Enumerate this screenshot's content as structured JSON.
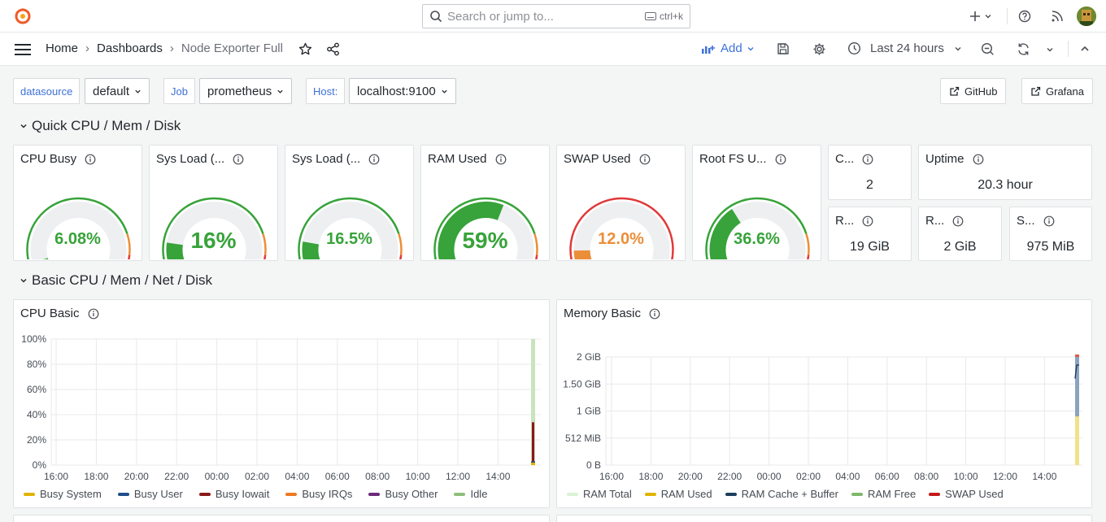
{
  "topbar": {
    "search_placeholder": "Search or jump to...",
    "search_shortcut": "ctrl+k",
    "icons": [
      "grafana-logo-icon",
      "search-icon",
      "plus-icon",
      "help-icon",
      "rss-icon",
      "user-avatar"
    ]
  },
  "navbar": {
    "breadcrumbs": [
      "Home",
      "Dashboards",
      "Node Exporter Full"
    ],
    "add_label": "Add",
    "time_range": "Last 24 hours"
  },
  "variables": {
    "datasource_label": "datasource",
    "datasource_value": "default",
    "job_label": "Job",
    "job_value": "prometheus",
    "host_label": "Host:",
    "host_value": "localhost:9100",
    "links": [
      "GitHub",
      "Grafana"
    ]
  },
  "rows": {
    "quick": "Quick CPU / Mem / Disk",
    "basic": "Basic CPU / Mem / Net / Disk"
  },
  "gauges": [
    {
      "title": "CPU Busy",
      "value": "6.08%",
      "fraction": 0.0608,
      "color": "#37a33a"
    },
    {
      "title": "Sys Load (...",
      "value": "16%",
      "fraction": 0.16,
      "color": "#37a33a"
    },
    {
      "title": "Sys Load (...",
      "value": "16.5%",
      "fraction": 0.165,
      "color": "#37a33a"
    },
    {
      "title": "RAM Used",
      "value": "59%",
      "fraction": 0.59,
      "color": "#37a33a"
    },
    {
      "title": "SWAP Used",
      "value": "12.0%",
      "fraction": 0.12,
      "color": "#ec8e38"
    },
    {
      "title": "Root FS U...",
      "value": "36.6%",
      "fraction": 0.366,
      "color": "#37a33a"
    }
  ],
  "stats": {
    "cores_title": "C...",
    "cores_value": "2",
    "uptime_title": "Uptime",
    "uptime_value": "20.3 hour",
    "rootfs_title": "R...",
    "rootfs_value": "19 GiB",
    "ram_title": "R...",
    "ram_value": "2 GiB",
    "swap_title": "S...",
    "swap_value": "975 MiB"
  },
  "cpu_panel": {
    "title": "CPU Basic",
    "legend": [
      {
        "name": "Busy System",
        "color": "#e0b400"
      },
      {
        "name": "Busy User",
        "color": "#1f4e8a"
      },
      {
        "name": "Busy Iowait",
        "color": "#8a1a1a"
      },
      {
        "name": "Busy IRQs",
        "color": "#ec7a22"
      },
      {
        "name": "Busy Other",
        "color": "#6d2a7a"
      },
      {
        "name": "Idle",
        "color": "#8fbf7a"
      }
    ]
  },
  "mem_panel": {
    "title": "Memory Basic",
    "legend": [
      {
        "name": "RAM Total",
        "color": "#d8f3d3"
      },
      {
        "name": "RAM Used",
        "color": "#e0b400"
      },
      {
        "name": "RAM Cache + Buffer",
        "color": "#1c3d5c"
      },
      {
        "name": "RAM Free",
        "color": "#7fb86b"
      },
      {
        "name": "SWAP Used",
        "color": "#c41a1a"
      }
    ]
  },
  "chart_data": [
    {
      "type": "area",
      "title": "CPU Basic",
      "x": [
        "16:00",
        "18:00",
        "20:00",
        "22:00",
        "00:00",
        "02:00",
        "04:00",
        "06:00",
        "08:00",
        "10:00",
        "12:00",
        "14:00"
      ],
      "yticks": [
        "0%",
        "20%",
        "40%",
        "60%",
        "80%",
        "100%"
      ],
      "ylim": [
        0,
        100
      ],
      "series": [
        {
          "name": "Busy System",
          "values": [
            2
          ]
        },
        {
          "name": "Busy User",
          "values": [
            3
          ]
        },
        {
          "name": "Busy Iowait",
          "values": [
            34
          ]
        },
        {
          "name": "Busy IRQs",
          "values": [
            0
          ]
        },
        {
          "name": "Busy Other",
          "values": [
            0
          ]
        },
        {
          "name": "Idle",
          "values": [
            100
          ]
        }
      ]
    },
    {
      "type": "area",
      "title": "Memory Basic",
      "x": [
        "16:00",
        "18:00",
        "20:00",
        "22:00",
        "00:00",
        "02:00",
        "04:00",
        "06:00",
        "08:00",
        "10:00",
        "12:00",
        "14:00"
      ],
      "yticks": [
        "0 B",
        "512 MiB",
        "1 GiB",
        "1.50 GiB",
        "2 GiB"
      ],
      "series": [
        {
          "name": "RAM Total",
          "values": [
            2.0
          ]
        },
        {
          "name": "RAM Used",
          "values": [
            0.9
          ]
        },
        {
          "name": "RAM Cache + Buffer",
          "values": [
            1.85
          ]
        },
        {
          "name": "RAM Free",
          "values": [
            0.1
          ]
        },
        {
          "name": "SWAP Used",
          "values": [
            2.0
          ]
        }
      ]
    }
  ]
}
